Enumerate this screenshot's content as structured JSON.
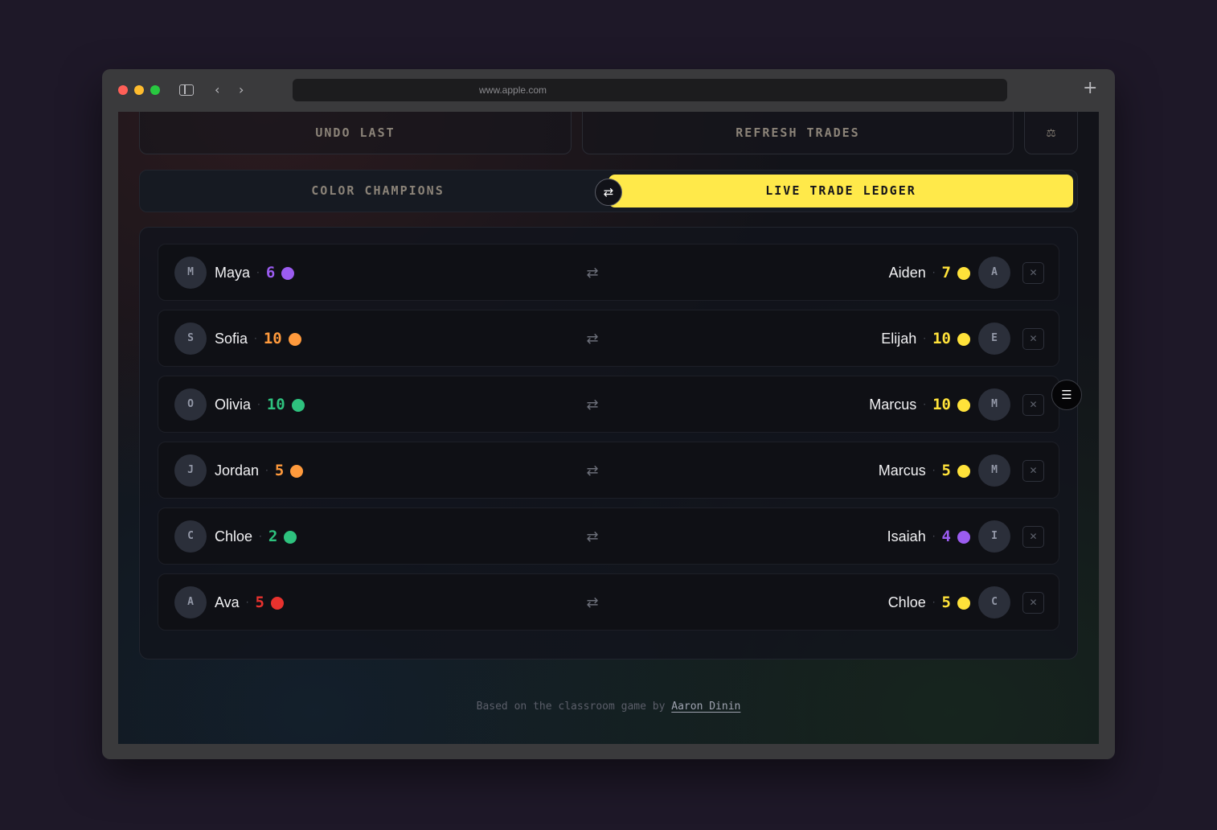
{
  "browser": {
    "url": "www.apple.com"
  },
  "actions": {
    "undo_label": "UNDO LAST",
    "refresh_label": "REFRESH TRADES"
  },
  "tabs": [
    {
      "label": "COLOR CHAMPIONS",
      "active": false
    },
    {
      "label": "LIVE TRADE LEDGER",
      "active": true
    }
  ],
  "trades": [
    {
      "from": {
        "initial": "M",
        "name": "Maya",
        "count": "6",
        "color": "#9b5cf0"
      },
      "to": {
        "initial": "A",
        "name": "Aiden",
        "count": "7",
        "color": "#ffe23a"
      }
    },
    {
      "from": {
        "initial": "S",
        "name": "Sofia",
        "count": "10",
        "color": "#ff9a3c"
      },
      "to": {
        "initial": "E",
        "name": "Elijah",
        "count": "10",
        "color": "#ffe23a"
      }
    },
    {
      "from": {
        "initial": "O",
        "name": "Olivia",
        "count": "10",
        "color": "#2ec27e"
      },
      "to": {
        "initial": "M",
        "name": "Marcus",
        "count": "10",
        "color": "#ffe23a"
      }
    },
    {
      "from": {
        "initial": "J",
        "name": "Jordan",
        "count": "5",
        "color": "#ff9a3c"
      },
      "to": {
        "initial": "M",
        "name": "Marcus",
        "count": "5",
        "color": "#ffe23a"
      }
    },
    {
      "from": {
        "initial": "C",
        "name": "Chloe",
        "count": "2",
        "color": "#2ec27e"
      },
      "to": {
        "initial": "I",
        "name": "Isaiah",
        "count": "4",
        "color": "#9b5cf0"
      }
    },
    {
      "from": {
        "initial": "A",
        "name": "Ava",
        "count": "5",
        "color": "#e8322e"
      },
      "to": {
        "initial": "C",
        "name": "Chloe",
        "count": "5",
        "color": "#ffe23a"
      }
    }
  ],
  "footer": {
    "prefix": "Based on the classroom game by ",
    "author": "Aaron Dinin"
  }
}
